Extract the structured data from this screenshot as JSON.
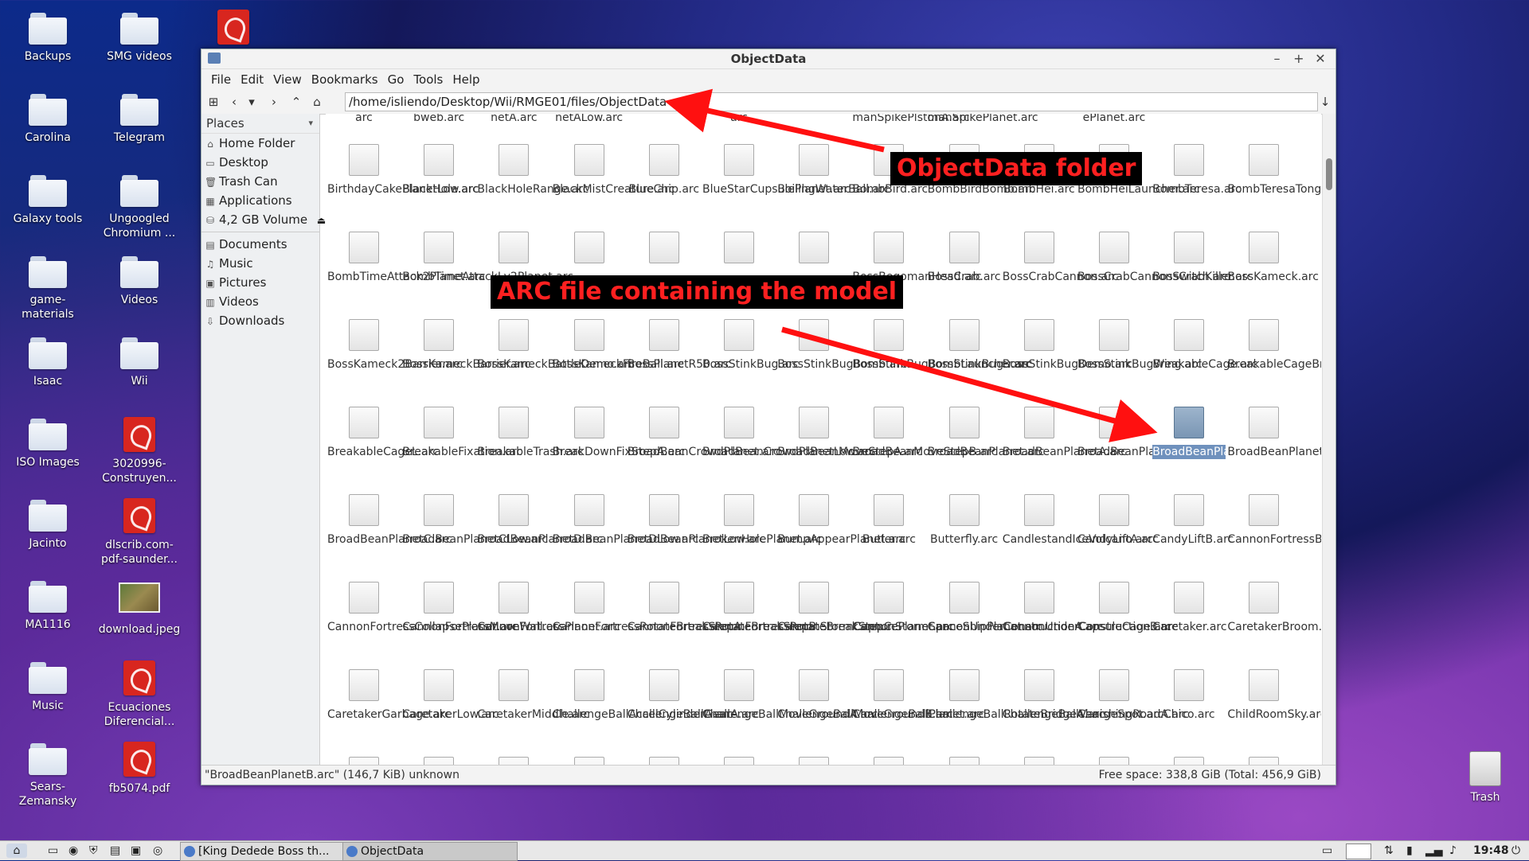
{
  "desktop": {
    "icons": [
      {
        "label": "Backups",
        "type": "folder"
      },
      {
        "label": "SMG videos",
        "type": "folder"
      },
      {
        "label": "Carolina",
        "type": "folder"
      },
      {
        "label": "Telegram",
        "type": "folder"
      },
      {
        "label": "Galaxy tools",
        "type": "folder"
      },
      {
        "label": "Ungoogled Chromium ...",
        "type": "folder"
      },
      {
        "label": "game-materials",
        "type": "folder"
      },
      {
        "label": "Videos",
        "type": "folder"
      },
      {
        "label": "Isaac",
        "type": "folder"
      },
      {
        "label": "Wii",
        "type": "folder"
      },
      {
        "label": "ISO Images",
        "type": "folder"
      },
      {
        "label": "3020996-Construyen...",
        "type": "pdf"
      },
      {
        "label": "Jacinto",
        "type": "folder"
      },
      {
        "label": "dlscrib.com-pdf-saunder...",
        "type": "pdf"
      },
      {
        "label": "MA1116",
        "type": "folder"
      },
      {
        "label": "download.jpeg",
        "type": "image"
      },
      {
        "label": "Music",
        "type": "folder"
      },
      {
        "label": "Ecuaciones Diferencial...",
        "type": "pdf"
      },
      {
        "label": "Sears-Zemansky",
        "type": "folder"
      },
      {
        "label": "fb5074.pdf",
        "type": "pdf"
      }
    ],
    "trash_label": "Trash"
  },
  "window": {
    "title": "ObjectData",
    "menu": [
      "File",
      "Edit",
      "View",
      "Bookmarks",
      "Go",
      "Tools",
      "Help"
    ],
    "path": "/home/isliendo/Desktop/Wii/RMGE01/files/ObjectData",
    "places_label": "Places",
    "places": [
      {
        "label": "Home Folder",
        "icon": "home-icon"
      },
      {
        "label": "Desktop",
        "icon": "desktop-icon"
      },
      {
        "label": "Trash Can",
        "icon": "trash-icon"
      },
      {
        "label": "Applications",
        "icon": "applications-icon"
      },
      {
        "label": "4,2 GB Volume",
        "icon": "drive-icon"
      }
    ],
    "bookmarks": [
      {
        "label": "Documents",
        "icon": "documents-icon"
      },
      {
        "label": "Music",
        "icon": "music-icon"
      },
      {
        "label": "Pictures",
        "icon": "pictures-icon"
      },
      {
        "label": "Videos",
        "icon": "videos-icon"
      },
      {
        "label": "Downloads",
        "icon": "downloads-icon"
      }
    ],
    "top_partial_row": [
      "arc",
      "bweb.arc",
      "netA.arc",
      "netALow.arc",
      "",
      "arc",
      "",
      "manSpikePlstonA.arc",
      "manSpikePlanet.arc",
      "",
      "ePlanet.arc"
    ],
    "files": [
      [
        "BirthdayCakePlanetLow.arc",
        "BlackHole.arc",
        "BlackHoleRange.arc",
        "BlackMistCreature.arc",
        "BlueChip.arc",
        "BlueStarCupsulePlanet.arc",
        "BoilingWaterBall.arc",
        "BombBird.arc",
        "BombBirdBomb.arc",
        "BombHei.arc",
        "BombHeiLauncher.arc",
        "BombTeresa.arc",
        "BombTeresaTongue.arc"
      ],
      [
        "BombTimeAttack2Planet.arc",
        "BombTimeAttackLv2Planet.arc",
        "",
        "",
        "",
        "",
        "",
        "BossBegomanHead.arc",
        "BossCrab.arc",
        "BossCrabCannon.arc",
        "BossCrabCannonSwitch.arc",
        "BossCrabKiller.arc",
        "BossKameck.arc"
      ],
      [
        "BossKameck2Barrier.arc",
        "BossKameckBarrier.arc",
        "BossKameckBattleDemo.arc",
        "BossKameckFireBall.arc",
        "BossPlanetR50.arc",
        "BossStinkBug.arc",
        "BossStinkBugBomb.arc",
        "BossStinkBugBombLauncher.arc",
        "BossStinkBug...arc",
        "BossStinkBugDemo.arc",
        "BossStinkBugWing.arc",
        "BreakableCage.arc",
        "BreakableCageBreak.arc"
      ],
      [
        "BreakableCageL.arc",
        "BreakableFixation.arc",
        "BreakableTrash.arc",
        "BreakDownFixStepA.arc",
        "BroadBeanCrowdPlanet.arc",
        "BroadBeanCrowdPlanetLow.arc",
        "BroadBeanMoveStepA.arc",
        "BroadBeanMoveStepB.arc",
        "BroadBeanPlanet.arc",
        "BroadBeanPlanetA.arc",
        "BroadBeanPlanetALow.arc",
        "BroadBeanPlanetB.arc",
        "BroadBeanPlanetBLow.arc"
      ],
      [
        "BroadBeanPlanetC.arc",
        "BroadBeanPlanetCLow.arc",
        "BroadBeanPlanetD.arc",
        "BroadBeanPlanetDLow.arc",
        "BroadBeanPlanetLow.arc",
        "BrokenHolePlanet.arc",
        "BumpAppearPlanet.arc",
        "Butler.arc",
        "Butterfly.arc",
        "CandlestandIceVolcano.arc",
        "CandyLiftA.arc",
        "CandyLiftB.arc",
        "CannonFortressBreakStepA.arc"
      ],
      [
        "CannonFortressCollapsePlanet.arc",
        "CannonFortressMoveWall.arc",
        "CannonFortressPlanet.arc",
        "CannonFortressRotateBreakStepA...",
        "CannonFortressRotateBreakStepB...",
        "CannonFortressRotateBreakStepC...",
        "CannonStormCapturePlanet.arc",
        "CannonStormSpaceShipPlanet.arc",
        "CannonUnderConstructionA.arc",
        "CannonUnderConstructionB.arc",
        "CapsuleCage.arc",
        "Caretaker.arc",
        "CaretakerBroom.arc"
      ],
      [
        "CaretakerGarbage.arc",
        "CaretakerLow.arc",
        "CaretakerMiddle.arc",
        "ChallengeBallAccelCylinderA.arc",
        "ChallengeBallGearA.arc",
        "ChallengeBallMoveGroundA.arc",
        "ChallengeBallMoveGroundB.arc",
        "ChallengeBallPlanet.arc",
        "ChallengeBallRotateBridgeA.arc",
        "ChallengeBallVanishingRoadA.arc",
        "ChargeSpot.arc",
        "Chico.arc",
        "ChildRoomSky.arc"
      ]
    ],
    "selected_file": "BroadBeanPlanetB.arc",
    "status_left": "\"BroadBeanPlanetB.arc\" (146,7 KiB) unknown",
    "status_right": "Free space: 338,8 GiB (Total: 456,9 GiB)"
  },
  "annotations": {
    "folder_label": "ObjectData folder",
    "model_label": "ARC file containing the model"
  },
  "taskbar": {
    "tasks": [
      "[King Dedede Boss th...",
      "ObjectData"
    ],
    "clock": "19:48"
  },
  "colors": {
    "annotation_text": "#ff2020",
    "annotation_bg": "#000000",
    "arrow": "#ff1010",
    "selection": "#6f91bd"
  }
}
